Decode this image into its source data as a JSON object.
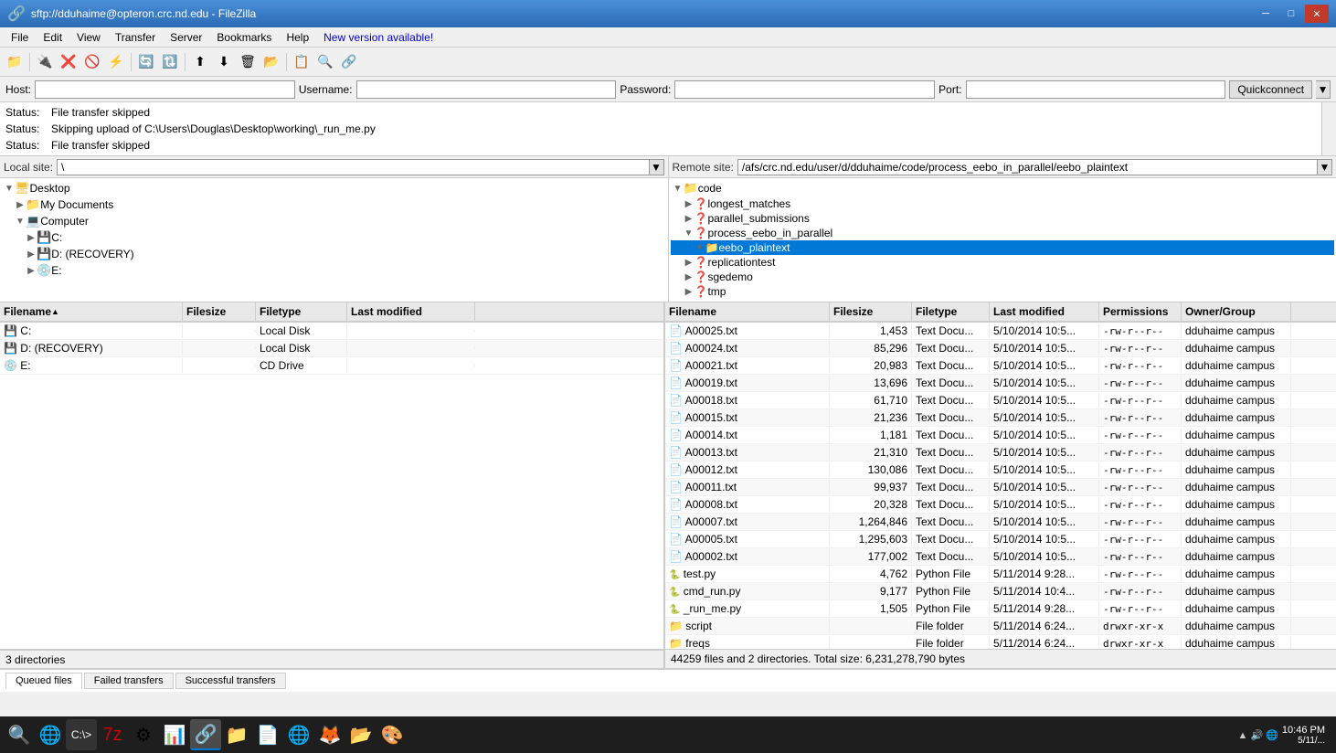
{
  "titleBar": {
    "title": "sftp://dduhaime@opteron.crc.nd.edu - FileZilla",
    "icon": "fz"
  },
  "menuBar": {
    "items": [
      "File",
      "Edit",
      "View",
      "Transfer",
      "Server",
      "Bookmarks",
      "Help",
      "New version available!"
    ]
  },
  "quickConnect": {
    "hostLabel": "Host:",
    "usernameLabel": "Username:",
    "passwordLabel": "Password:",
    "portLabel": "Port:",
    "hostValue": "",
    "usernameValue": "",
    "passwordValue": "",
    "portValue": "",
    "buttonLabel": "Quickconnect"
  },
  "statusLines": [
    {
      "label": "Status:",
      "text": "File transfer skipped"
    },
    {
      "label": "Status:",
      "text": "Skipping upload of C:\\Users\\Douglas\\Desktop\\working\\_run_me.py"
    },
    {
      "label": "Status:",
      "text": "File transfer skipped"
    }
  ],
  "localPanel": {
    "label": "Local site:",
    "path": "\\",
    "tree": [
      {
        "indent": 0,
        "expanded": true,
        "icon": "desktop",
        "label": "Desktop"
      },
      {
        "indent": 1,
        "expanded": false,
        "icon": "folder",
        "label": "My Documents"
      },
      {
        "indent": 1,
        "expanded": true,
        "icon": "computer",
        "label": "Computer"
      },
      {
        "indent": 2,
        "expanded": false,
        "icon": "drive",
        "label": "C:"
      },
      {
        "indent": 2,
        "expanded": false,
        "icon": "drive",
        "label": "D: (RECOVERY)"
      },
      {
        "indent": 2,
        "expanded": false,
        "icon": "drive",
        "label": "E:"
      }
    ],
    "columns": [
      "Filename",
      "Filesize",
      "Filetype",
      "Last modified"
    ],
    "files": [
      {
        "name": "C:",
        "size": "",
        "type": "Local Disk",
        "modified": ""
      },
      {
        "name": "D: (RECOVERY)",
        "size": "",
        "type": "Local Disk",
        "modified": ""
      },
      {
        "name": "E:",
        "size": "",
        "type": "CD Drive",
        "modified": ""
      }
    ],
    "statusText": "3 directories"
  },
  "remotePanel": {
    "label": "Remote site:",
    "path": "/afs/crc.nd.edu/user/d/dduhaime/code/process_eebo_in_parallel/eebo_plaintext",
    "tree": [
      {
        "indent": 0,
        "expanded": true,
        "icon": "folder",
        "label": "code"
      },
      {
        "indent": 1,
        "expanded": false,
        "icon": "folder-q",
        "label": "longest_matches"
      },
      {
        "indent": 1,
        "expanded": false,
        "icon": "folder-q",
        "label": "parallel_submissions"
      },
      {
        "indent": 1,
        "expanded": true,
        "icon": "folder-q",
        "label": "process_eebo_in_parallel"
      },
      {
        "indent": 2,
        "expanded": true,
        "icon": "folder-q",
        "label": "eebo_plaintext"
      },
      {
        "indent": 1,
        "expanded": false,
        "icon": "folder-q",
        "label": "replicationtest"
      },
      {
        "indent": 1,
        "expanded": false,
        "icon": "folder-q",
        "label": "sgedemo"
      },
      {
        "indent": 1,
        "expanded": false,
        "icon": "folder-q",
        "label": "tmp"
      }
    ],
    "columns": [
      "Filename",
      "Filesize",
      "Filetype",
      "Last modified",
      "Permissions",
      "Owner/Group"
    ],
    "files": [
      {
        "name": "A00025.txt",
        "size": "1,453",
        "type": "Text Docu...",
        "modified": "5/10/2014 10:5...",
        "perms": "-rw-r--r--",
        "owner": "dduhaime campus"
      },
      {
        "name": "A00024.txt",
        "size": "85,296",
        "type": "Text Docu...",
        "modified": "5/10/2014 10:5...",
        "perms": "-rw-r--r--",
        "owner": "dduhaime campus"
      },
      {
        "name": "A00021.txt",
        "size": "20,983",
        "type": "Text Docu...",
        "modified": "5/10/2014 10:5...",
        "perms": "-rw-r--r--",
        "owner": "dduhaime campus"
      },
      {
        "name": "A00019.txt",
        "size": "13,696",
        "type": "Text Docu...",
        "modified": "5/10/2014 10:5...",
        "perms": "-rw-r--r--",
        "owner": "dduhaime campus"
      },
      {
        "name": "A00018.txt",
        "size": "61,710",
        "type": "Text Docu...",
        "modified": "5/10/2014 10:5...",
        "perms": "-rw-r--r--",
        "owner": "dduhaime campus"
      },
      {
        "name": "A00015.txt",
        "size": "21,236",
        "type": "Text Docu...",
        "modified": "5/10/2014 10:5...",
        "perms": "-rw-r--r--",
        "owner": "dduhaime campus"
      },
      {
        "name": "A00014.txt",
        "size": "1,181",
        "type": "Text Docu...",
        "modified": "5/10/2014 10:5...",
        "perms": "-rw-r--r--",
        "owner": "dduhaime campus"
      },
      {
        "name": "A00013.txt",
        "size": "21,310",
        "type": "Text Docu...",
        "modified": "5/10/2014 10:5...",
        "perms": "-rw-r--r--",
        "owner": "dduhaime campus"
      },
      {
        "name": "A00012.txt",
        "size": "130,086",
        "type": "Text Docu...",
        "modified": "5/10/2014 10:5...",
        "perms": "-rw-r--r--",
        "owner": "dduhaime campus"
      },
      {
        "name": "A00011.txt",
        "size": "99,937",
        "type": "Text Docu...",
        "modified": "5/10/2014 10:5...",
        "perms": "-rw-r--r--",
        "owner": "dduhaime campus"
      },
      {
        "name": "A00008.txt",
        "size": "20,328",
        "type": "Text Docu...",
        "modified": "5/10/2014 10:5...",
        "perms": "-rw-r--r--",
        "owner": "dduhaime campus"
      },
      {
        "name": "A00007.txt",
        "size": "1,264,846",
        "type": "Text Docu...",
        "modified": "5/10/2014 10:5...",
        "perms": "-rw-r--r--",
        "owner": "dduhaime campus"
      },
      {
        "name": "A00005.txt",
        "size": "1,295,603",
        "type": "Text Docu...",
        "modified": "5/10/2014 10:5...",
        "perms": "-rw-r--r--",
        "owner": "dduhaime campus"
      },
      {
        "name": "A00002.txt",
        "size": "177,002",
        "type": "Text Docu...",
        "modified": "5/10/2014 10:5...",
        "perms": "-rw-r--r--",
        "owner": "dduhaime campus"
      },
      {
        "name": "test.py",
        "size": "4,762",
        "type": "Python File",
        "modified": "5/11/2014 9:28...",
        "perms": "-rw-r--r--",
        "owner": "dduhaime campus"
      },
      {
        "name": "cmd_run.py",
        "size": "9,177",
        "type": "Python File",
        "modified": "5/11/2014 10:4...",
        "perms": "-rw-r--r--",
        "owner": "dduhaime campus"
      },
      {
        "name": "_run_me.py",
        "size": "1,505",
        "type": "Python File",
        "modified": "5/11/2014 9:28...",
        "perms": "-rw-r--r--",
        "owner": "dduhaime campus"
      },
      {
        "name": "script",
        "size": "",
        "type": "File folder",
        "modified": "5/11/2014 6:24...",
        "perms": "drwxr-xr-x",
        "owner": "dduhaime campus"
      },
      {
        "name": "freqs",
        "size": "",
        "type": "File folder",
        "modified": "5/11/2014 6:24...",
        "perms": "drwxr-xr-x",
        "owner": "dduhaime campus"
      }
    ],
    "statusText": "44259 files and 2 directories. Total size: 6,231,278,790 bytes"
  },
  "transferQueue": {
    "tabs": [
      "Queued files",
      "Failed transfers",
      "Successful transfers"
    ]
  },
  "taskbar": {
    "time": "10:46 PM",
    "date": "5/11/..."
  }
}
